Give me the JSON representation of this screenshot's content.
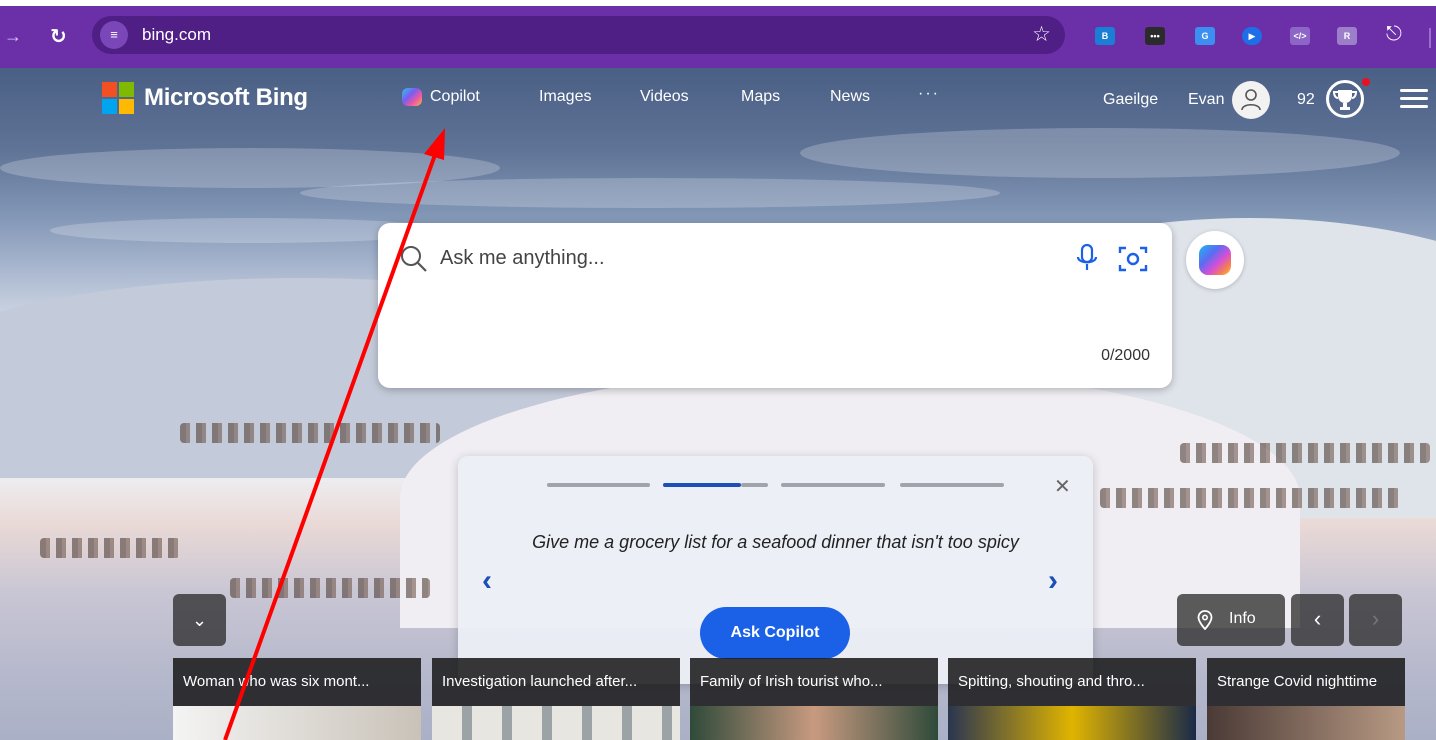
{
  "browser": {
    "url": "bing.com",
    "extensions": [
      "ext-1",
      "ext-2",
      "ext-3",
      "ext-4",
      "ext-5",
      "ext-6"
    ]
  },
  "header": {
    "logo_text": "Microsoft Bing",
    "nav": {
      "copilot": "Copilot",
      "images": "Images",
      "videos": "Videos",
      "maps": "Maps",
      "news": "News",
      "more": "···"
    },
    "language": "Gaeilge",
    "user_name": "Evan",
    "points": "92"
  },
  "search": {
    "placeholder": "Ask me anything...",
    "counter": "0/2000"
  },
  "suggestion_card": {
    "text": "Give me a grocery list for a seafood dinner that isn't too spicy",
    "button": "Ask Copilot",
    "progress_steps": 4,
    "active_step": 2
  },
  "background_controls": {
    "info": "Info"
  },
  "news_tiles": [
    {
      "title": "Woman who was six mont..."
    },
    {
      "title": "Investigation launched after..."
    },
    {
      "title": "Family of Irish tourist who..."
    },
    {
      "title": "Spitting, shouting and thro..."
    },
    {
      "title": "Strange Covid nighttime"
    }
  ],
  "colors": {
    "browser_bar": "#6b2fa8",
    "accent": "#1a61e8",
    "annotation": "#ff0000"
  }
}
